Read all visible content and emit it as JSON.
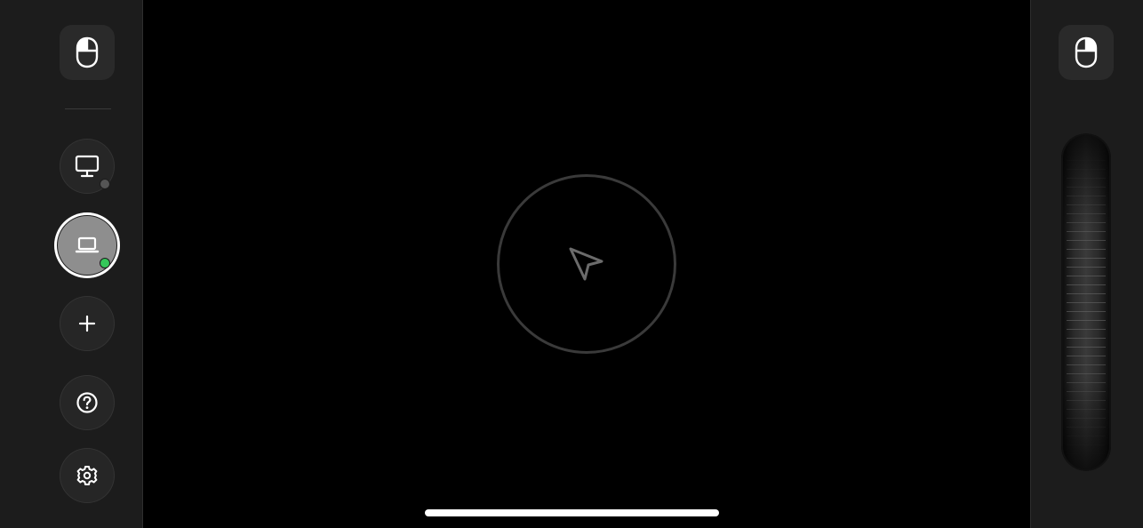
{
  "left_sidebar": {
    "mouse_button_icon": "mouse-icon",
    "devices": [
      {
        "icon": "desktop-monitor-icon",
        "status_color": "#555555",
        "selected": false
      },
      {
        "icon": "laptop-icon",
        "status_color": "#34c759",
        "selected": true
      }
    ],
    "add_button_icon": "plus-icon",
    "help_button_icon": "question-circle-icon",
    "settings_button_icon": "gear-icon"
  },
  "trackpad": {
    "icon": "cursor-arrow-icon"
  },
  "right_sidebar": {
    "mouse_button_icon": "mouse-icon",
    "scroll_wheel": "scroll-wheel"
  },
  "colors": {
    "background": "#000000",
    "sidebar": "#1c1c1c",
    "selected_device": "#8e8e8e",
    "online_status": "#34c759",
    "offline_status": "#555555",
    "home_indicator": "#ffffff"
  }
}
